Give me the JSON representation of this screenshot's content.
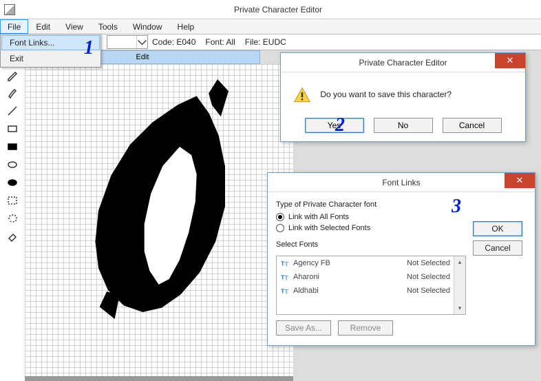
{
  "titlebar": {
    "title": "Private Character Editor"
  },
  "menu": {
    "items": [
      "File",
      "Edit",
      "View",
      "Tools",
      "Window",
      "Help"
    ],
    "file_dropdown": {
      "font_links": "Font Links...",
      "exit": "Exit"
    }
  },
  "inforow": {
    "code_label": "Code:",
    "code_value": "E040",
    "font_label": "Font:",
    "font_value": "All",
    "file_label": "File:",
    "file_value": "EUDC"
  },
  "edit_tab": "Edit",
  "tools": [
    "pencil",
    "brush",
    "line",
    "rect",
    "rect-fill",
    "ellipse",
    "ellipse-fill",
    "select-rect",
    "select-free",
    "eraser"
  ],
  "save_dialog": {
    "title": "Private Character Editor",
    "message": "Do you want to save this character?",
    "yes": "Yes",
    "no": "No",
    "cancel": "Cancel"
  },
  "font_dialog": {
    "title": "Font Links",
    "type_label": "Type of Private Character font",
    "opt_all": "Link with All Fonts",
    "opt_sel": "Link with Selected Fonts",
    "select_label": "Select Fonts",
    "fonts": [
      {
        "name": "Agency FB",
        "state": "Not Selected"
      },
      {
        "name": "Aharoni",
        "state": "Not Selected"
      },
      {
        "name": "Aldhabi",
        "state": "Not Selected"
      }
    ],
    "save_as": "Save As...",
    "remove": "Remove",
    "ok": "OK",
    "cancel": "Cancel"
  },
  "annotations": {
    "a1": "1",
    "a2": "2",
    "a3": "3"
  }
}
